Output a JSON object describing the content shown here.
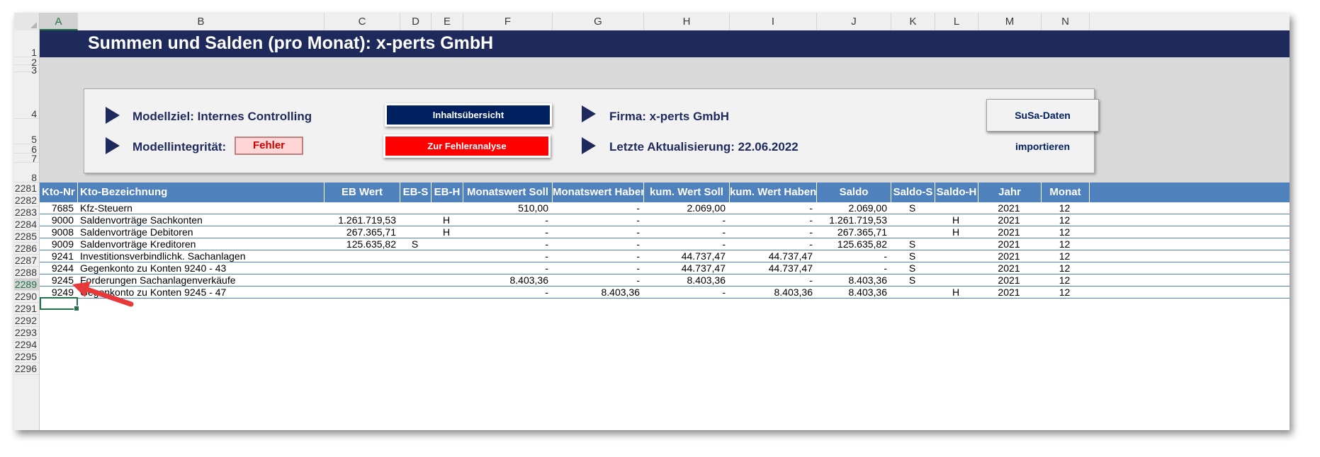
{
  "title": "Summen und Salden (pro Monat): x-perts GmbH",
  "columns": [
    "A",
    "B",
    "C",
    "D",
    "E",
    "F",
    "G",
    "H",
    "I",
    "J",
    "K",
    "L",
    "M",
    "N"
  ],
  "selected_column": "A",
  "top_rows": [
    "1",
    "2",
    "3",
    "4",
    "5",
    "6",
    "7",
    "8"
  ],
  "panel": {
    "modellziel": "Modellziel: Internes Controlling",
    "integritaet_label": "Modellintegrität:",
    "integritaet_value": "Fehler",
    "btn_inhalt": "Inhaltsübersicht",
    "btn_fehler": "Zur Fehleranalyse",
    "firma": "Firma: x-perts GmbH",
    "aktualisierung": "Letzte Aktualisierung: 22.06.2022"
  },
  "import_button": "SuSa-Daten importieren",
  "table_headers": [
    "Kto-Nr",
    "Kto-Bezeichnung",
    "EB Wert",
    "EB-S",
    "EB-H",
    "Monatswert Soll",
    "Monatswert Haben",
    "kum. Wert Soll",
    "kum. Wert Haben",
    "Saldo",
    "Saldo-S",
    "Saldo-H",
    "Jahr",
    "Monat"
  ],
  "rows": [
    {
      "rownum": "2281",
      "kto": "7685",
      "bez": "Kfz-Steuern",
      "eb": "",
      "ebs": "",
      "ebh": "",
      "msoll": "510,00",
      "mhaben": "-",
      "ksoll": "2.069,00",
      "khaben": "-",
      "saldo": "2.069,00",
      "salds": "S",
      "saldh": "",
      "jahr": "2021",
      "monat": "12"
    },
    {
      "rownum": "2282",
      "kto": "9000",
      "bez": "Saldenvorträge Sachkonten",
      "eb": "1.261.719,53",
      "ebs": "",
      "ebh": "H",
      "msoll": "-",
      "mhaben": "-",
      "ksoll": "-",
      "khaben": "-",
      "saldo": "1.261.719,53",
      "salds": "",
      "saldh": "H",
      "jahr": "2021",
      "monat": "12"
    },
    {
      "rownum": "2283",
      "kto": "9008",
      "bez": "Saldenvorträge Debitoren",
      "eb": "267.365,71",
      "ebs": "",
      "ebh": "H",
      "msoll": "-",
      "mhaben": "-",
      "ksoll": "-",
      "khaben": "-",
      "saldo": "267.365,71",
      "salds": "",
      "saldh": "H",
      "jahr": "2021",
      "monat": "12"
    },
    {
      "rownum": "2284",
      "kto": "9009",
      "bez": "Saldenvorträge Kreditoren",
      "eb": "125.635,82",
      "ebs": "S",
      "ebh": "",
      "msoll": "-",
      "mhaben": "-",
      "ksoll": "-",
      "khaben": "-",
      "saldo": "125.635,82",
      "salds": "S",
      "saldh": "",
      "jahr": "2021",
      "monat": "12"
    },
    {
      "rownum": "2285",
      "kto": "9241",
      "bez": "Investitionsverbindlichk. Sachanlagen",
      "eb": "",
      "ebs": "",
      "ebh": "",
      "msoll": "-",
      "mhaben": "-",
      "ksoll": "44.737,47",
      "khaben": "44.737,47",
      "saldo": "-",
      "salds": "S",
      "saldh": "",
      "jahr": "2021",
      "monat": "12"
    },
    {
      "rownum": "2286",
      "kto": "9244",
      "bez": "Gegenkonto zu Konten 9240 - 43",
      "eb": "",
      "ebs": "",
      "ebh": "",
      "msoll": "-",
      "mhaben": "-",
      "ksoll": "44.737,47",
      "khaben": "44.737,47",
      "saldo": "-",
      "salds": "S",
      "saldh": "",
      "jahr": "2021",
      "monat": "12"
    },
    {
      "rownum": "2287",
      "kto": "9245",
      "bez": "Forderungen Sachanlagenverkäufe",
      "eb": "",
      "ebs": "",
      "ebh": "",
      "msoll": "8.403,36",
      "mhaben": "-",
      "ksoll": "8.403,36",
      "khaben": "-",
      "saldo": "8.403,36",
      "salds": "S",
      "saldh": "",
      "jahr": "2021",
      "monat": "12"
    },
    {
      "rownum": "2288",
      "kto": "9249",
      "bez": "Gegenkonto zu Konten 9245 - 47",
      "eb": "",
      "ebs": "",
      "ebh": "",
      "msoll": "-",
      "mhaben": "8.403,36",
      "ksoll": "-",
      "khaben": "8.403,36",
      "saldo": "8.403,36",
      "salds": "",
      "saldh": "H",
      "jahr": "2021",
      "monat": "12"
    }
  ],
  "empty_rows": [
    "2289",
    "2290",
    "2291",
    "2292",
    "2293",
    "2294",
    "2295",
    "2296"
  ],
  "selected_row": "2289"
}
